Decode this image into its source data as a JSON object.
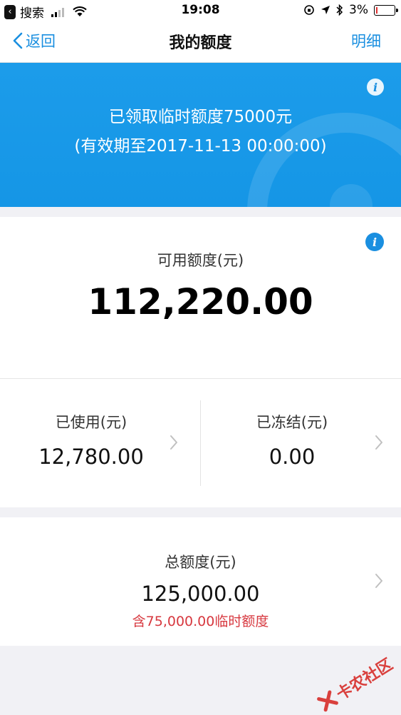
{
  "status_bar": {
    "back_app": "搜索",
    "time": "19:08",
    "battery": "3%"
  },
  "nav": {
    "back_label": "返回",
    "title": "我的额度",
    "detail_label": "明细"
  },
  "banner": {
    "line1": "已领取临时额度75000元",
    "line2": "(有效期至2017-11-13 00:00:00)"
  },
  "available": {
    "label": "可用额度(元)",
    "amount": "112,220.00"
  },
  "used": {
    "label": "已使用(元)",
    "amount": "12,780.00"
  },
  "frozen": {
    "label": "已冻结(元)",
    "amount": "0.00"
  },
  "total": {
    "label": "总额度(元)",
    "amount": "125,000.00",
    "note": "含75,000.00临时额度"
  },
  "watermark": {
    "text": "卡农社区"
  },
  "colors": {
    "accent": "#1a8fe0",
    "banner": "#1596e6",
    "note_red": "#d7383f"
  }
}
